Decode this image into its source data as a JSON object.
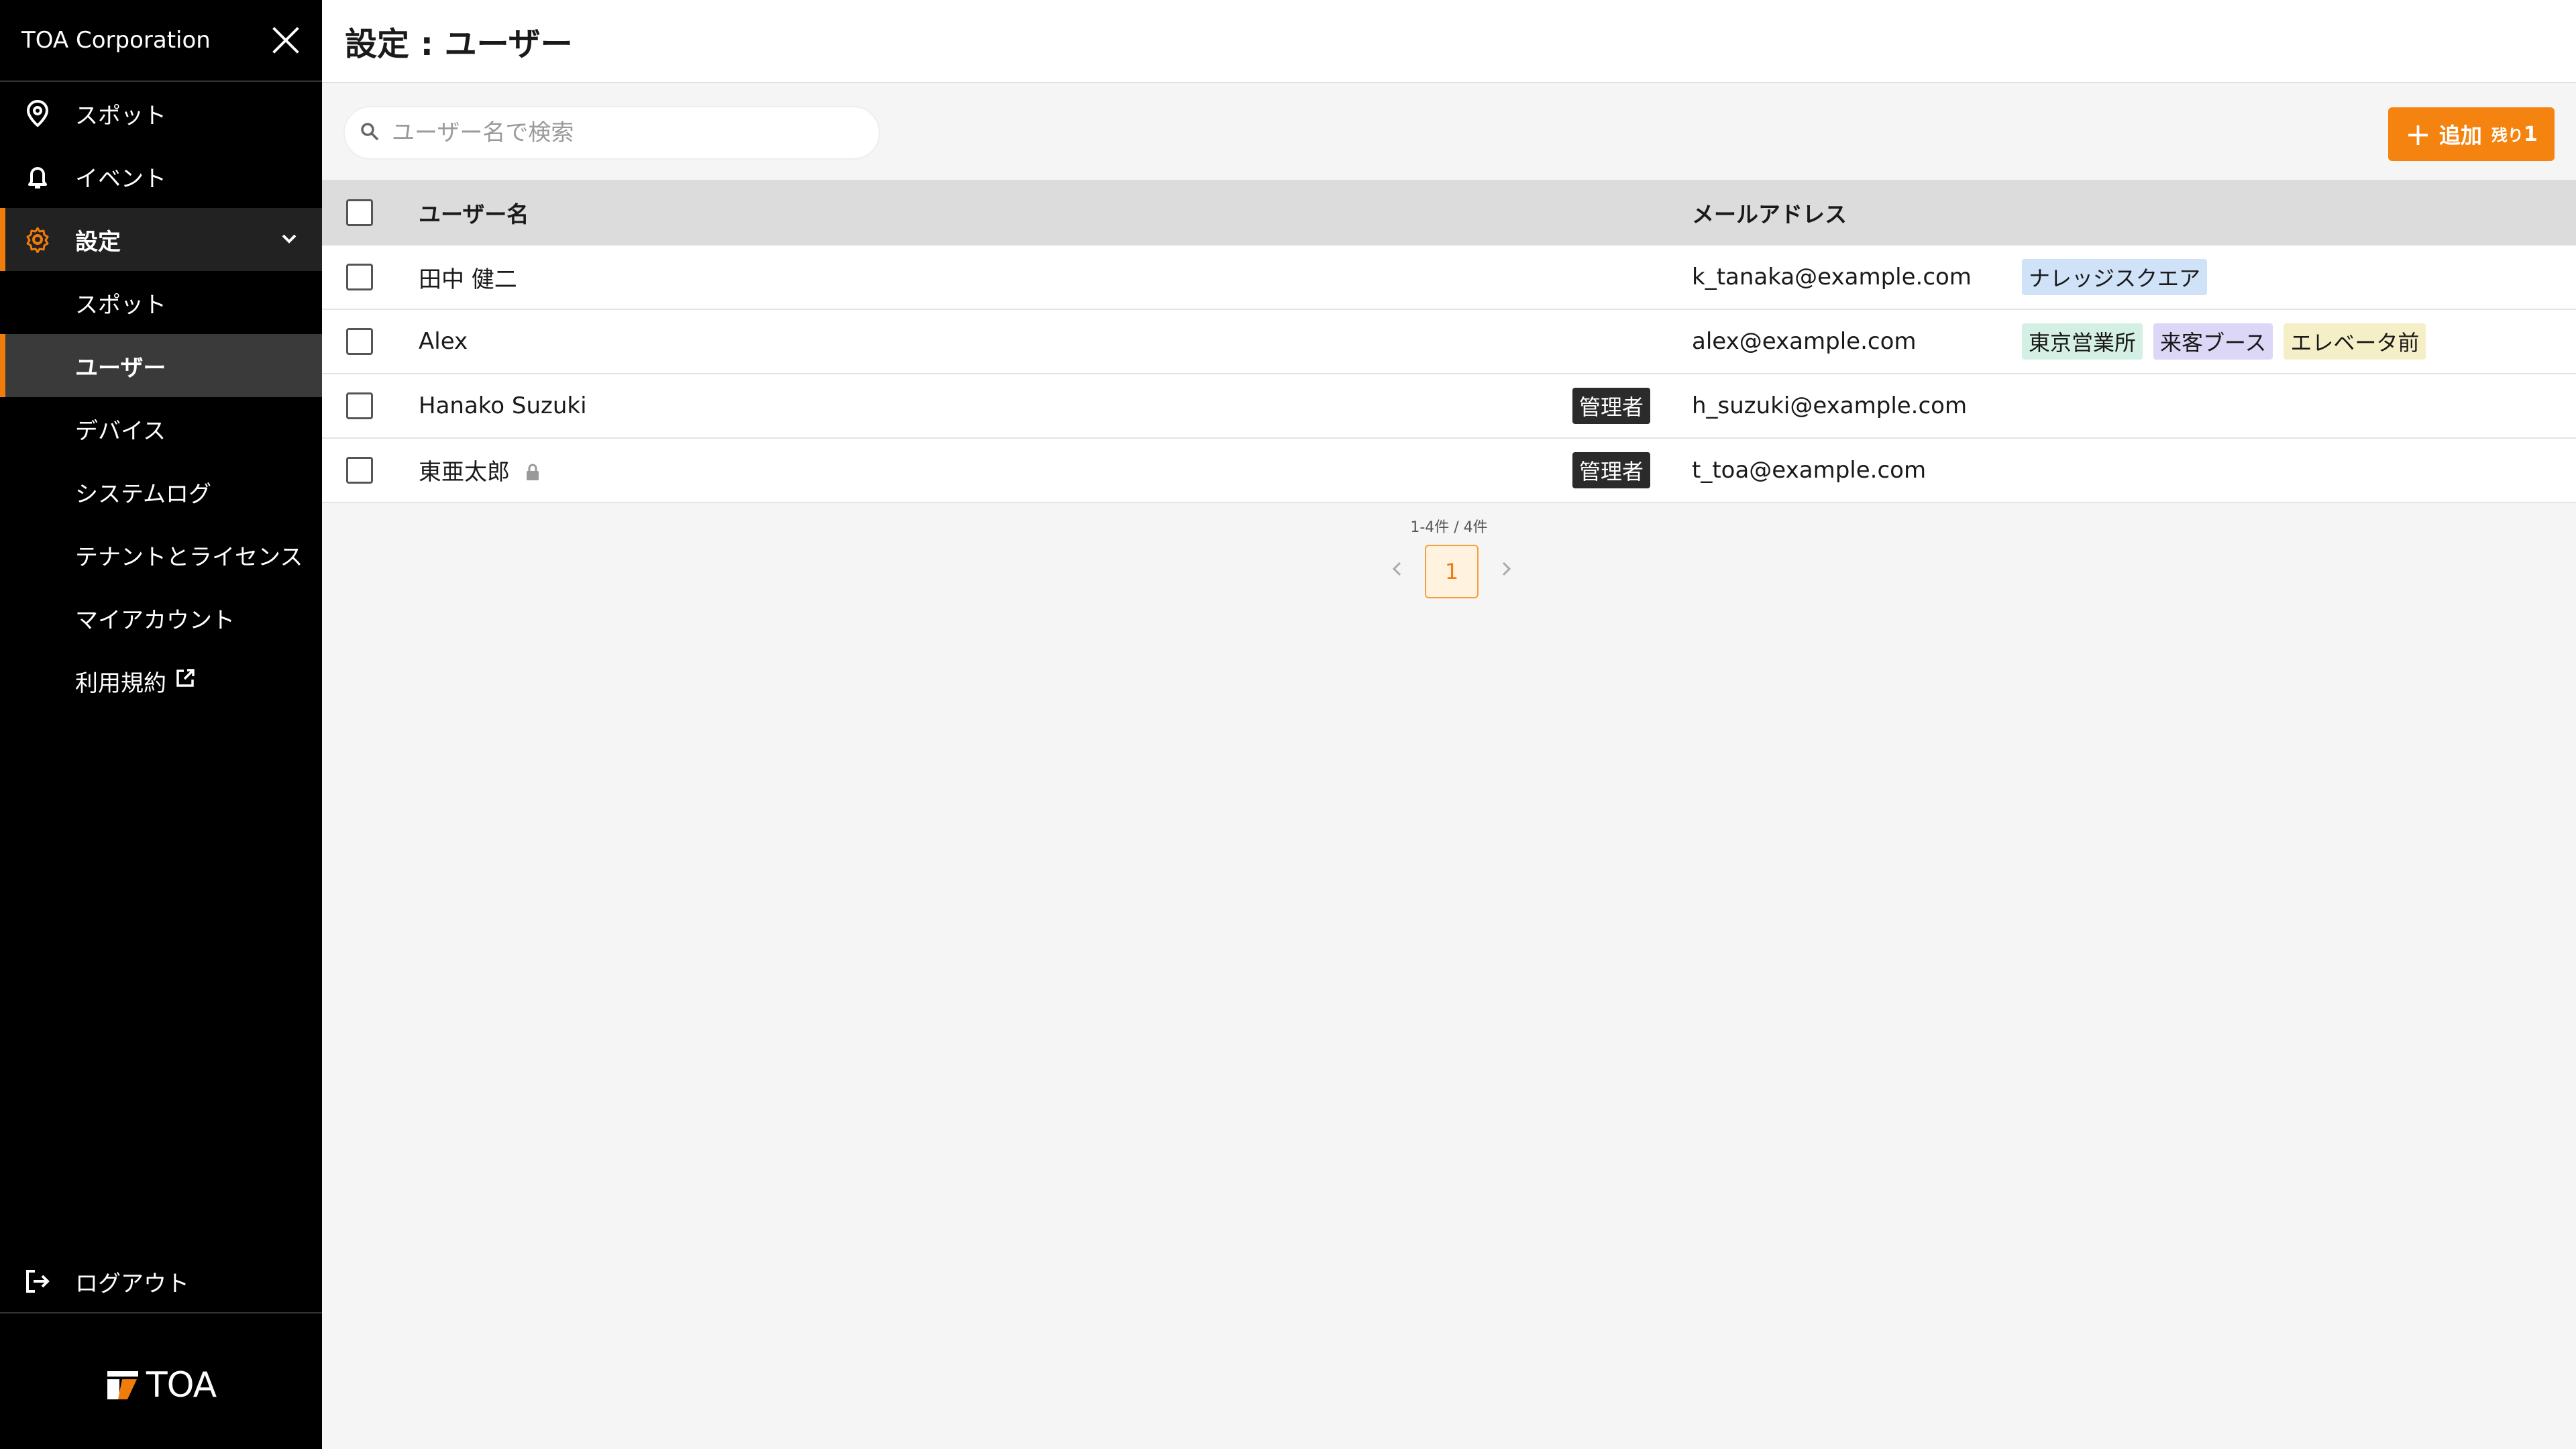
{
  "sidebar": {
    "org_name": "TOA Corporation",
    "nav": {
      "spot": "スポット",
      "event": "イベント",
      "settings": "設定"
    },
    "sub": {
      "spot": "スポット",
      "users": "ユーザー",
      "devices": "デバイス",
      "system_log": "システムログ",
      "tenant_license": "テナントとライセンス",
      "my_account": "マイアカウント",
      "terms": "利用規約"
    },
    "logout": "ログアウト",
    "brand": "TOA"
  },
  "header": {
    "title": "設定 : ユーザー"
  },
  "search": {
    "placeholder": "ユーザー名で検索"
  },
  "add_button": {
    "label": "追加",
    "remaining_label": "残り",
    "remaining_count": "1"
  },
  "table": {
    "columns": {
      "name": "ユーザー名",
      "email": "メールアドレス"
    },
    "rows": [
      {
        "name": "田中 健二",
        "email": "k_tanaka@example.com",
        "tags": [
          "ナレッジスクエア"
        ]
      },
      {
        "name": "Alex",
        "email": "alex@example.com",
        "tags": [
          "東京営業所",
          "来客ブース",
          "エレベータ前"
        ]
      },
      {
        "name": "Hanako Suzuki",
        "badge": "管理者",
        "email": "h_suzuki@example.com"
      },
      {
        "name": "東亜太郎",
        "badge": "管理者",
        "email": "t_toa@example.com"
      }
    ]
  },
  "pagination": {
    "count": "1-4件 / 4件",
    "current_page": "1"
  },
  "colors": {
    "accent": "#f5830f",
    "tag_blue": "#cfe2f8",
    "tag_green": "#d4f0e4",
    "tag_purple": "#dcd6f7",
    "tag_yellow": "#f5efc8"
  }
}
